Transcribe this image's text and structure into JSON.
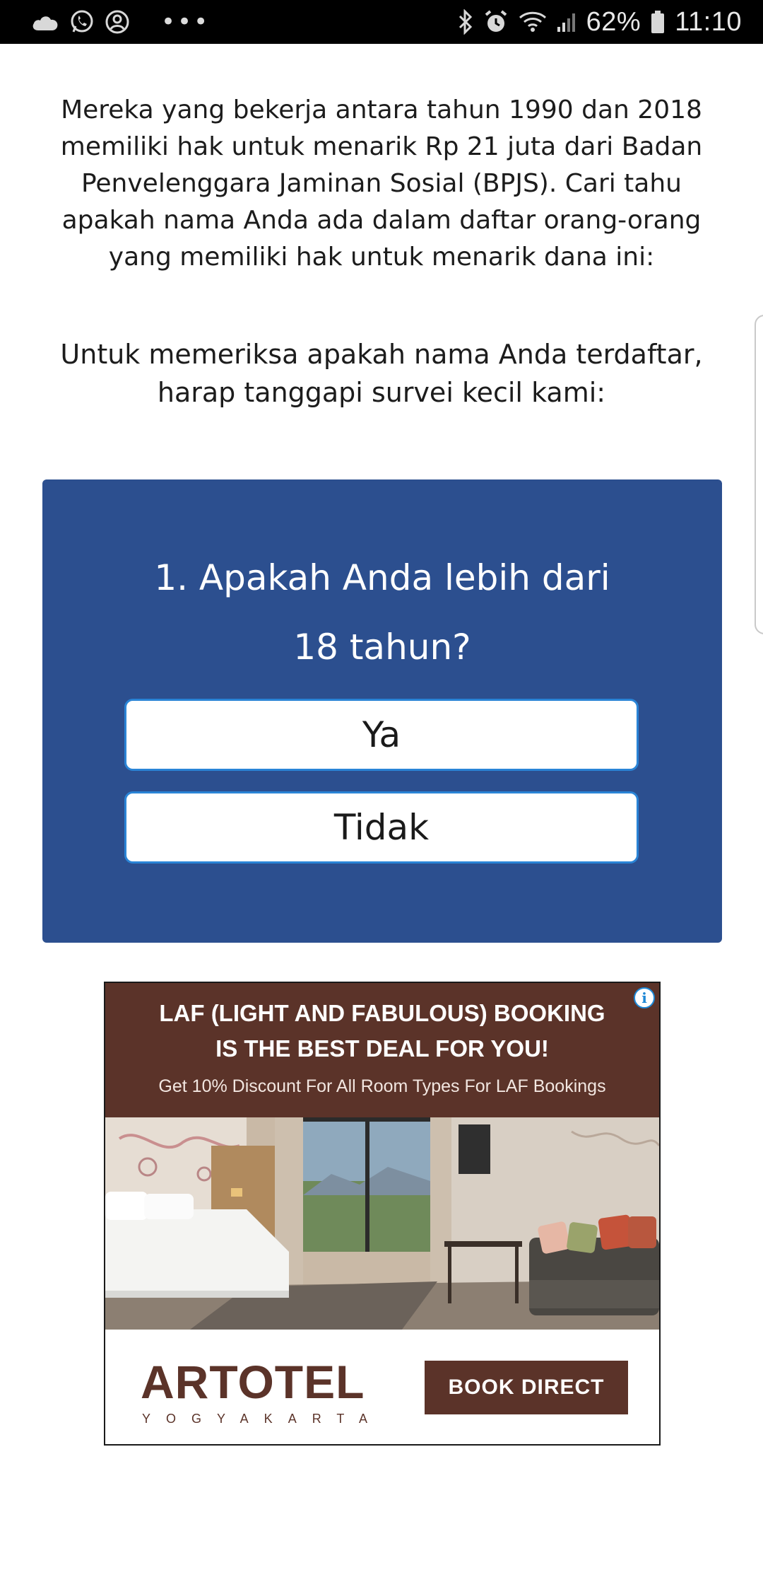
{
  "status_bar": {
    "left_icons": [
      "cloud-icon",
      "whatsapp-icon",
      "account-circle-icon"
    ],
    "more_indicator": "•••",
    "right_icons": [
      "bluetooth-icon",
      "alarm-icon",
      "wifi-icon",
      "signal-icon",
      "battery-icon"
    ],
    "battery": "62%",
    "time": "11:10"
  },
  "article": {
    "intro": "Mereka yang bekerja antara tahun 1990 dan 2018 memiliki hak untuk menarik Rp 21 juta dari Badan Penvelenggara Jaminan Sosial (BPJS). Cari tahu apakah nama Anda ada dalam daftar orang-orang yang memiliki hak untuk menarik dana ini:",
    "prompt": "Untuk memeriksa apakah nama Anda terdaftar, harap tanggapi survei kecil kami:"
  },
  "survey": {
    "question": "1. Apakah Anda lebih dari 18 tahun?",
    "answers": [
      "Ya",
      "Tidak"
    ],
    "bg_color": "#2c4f8f"
  },
  "ad": {
    "headline": "LAF (LIGHT AND FABULOUS) BOOKING\nIS THE BEST DEAL FOR YOU!",
    "subline": "Get 10% Discount For All Room Types For LAF Bookings",
    "info_icon": "info-icon",
    "brand": "ARTOTEL",
    "brand_city": "YOGYAKARTA",
    "cta": "BOOK DIRECT",
    "brand_color": "#5b3329"
  }
}
